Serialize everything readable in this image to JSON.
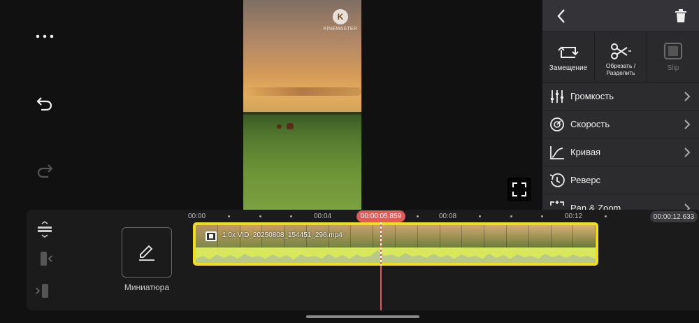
{
  "preview": {
    "watermark_letter": "K",
    "watermark_text": "KINEMASTER"
  },
  "panel": {
    "tools": [
      {
        "label": "Замещение",
        "icon": "replace-icon",
        "enabled": true
      },
      {
        "label": "Обрезать / Разделить",
        "icon": "scissors-icon",
        "enabled": true
      },
      {
        "label": "Slip",
        "icon": "slip-icon",
        "enabled": false
      }
    ],
    "menu": [
      {
        "label": "Громкость",
        "icon": "volume-sliders-icon"
      },
      {
        "label": "Скорость",
        "icon": "speed-icon"
      },
      {
        "label": "Кривая",
        "icon": "curve-icon"
      },
      {
        "label": "Реверс",
        "icon": "reverse-icon"
      },
      {
        "label": "Pan & Zoom",
        "icon": "pan-zoom-icon"
      }
    ]
  },
  "timeline": {
    "ruler": [
      "00:00",
      "00:04",
      "00:08",
      "00:12"
    ],
    "current_time": "00:00:05.859",
    "duration": "00:00:12.633",
    "thumbnail_label": "Миниатюра",
    "clip": {
      "name": "1.0x VID_20250808_154451_296.mp4"
    }
  },
  "colors": {
    "accent_yellow": "#f0de1d",
    "playhead_red": "#e05a5a",
    "panel_bg": "#2a2a2c"
  }
}
